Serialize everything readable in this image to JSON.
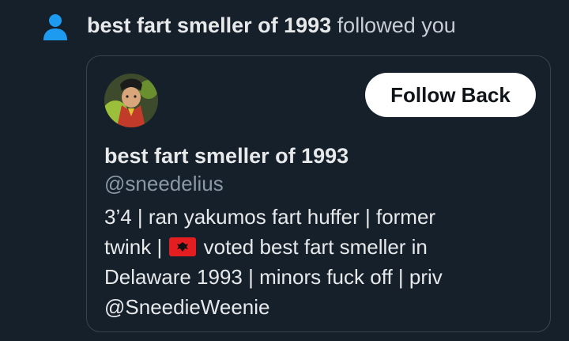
{
  "notification": {
    "icon": "person-icon",
    "name": "best fart smeller of 1993",
    "action": "followed you"
  },
  "profile_card": {
    "avatar_icon": "avatar",
    "follow_button_label": "Follow Back",
    "display_name": "best fart smeller of 1993",
    "handle": "@sneedelius",
    "bio": {
      "line1": "3’4 | ran yakumos fart huffer | former",
      "line2_before_flag": "twink | ",
      "flag_icon": "albania-flag-icon",
      "line2_after_flag": " voted best fart smeller in",
      "line3": "Delaware 1993 | minors fuck off | priv",
      "line4": "@SneedieWeenie"
    }
  },
  "colors": {
    "background": "#15202b",
    "accent_icon": "#1d9bf0",
    "button_bg": "#ffffff",
    "muted_text": "#8b98a5",
    "card_border": "#38444d"
  }
}
